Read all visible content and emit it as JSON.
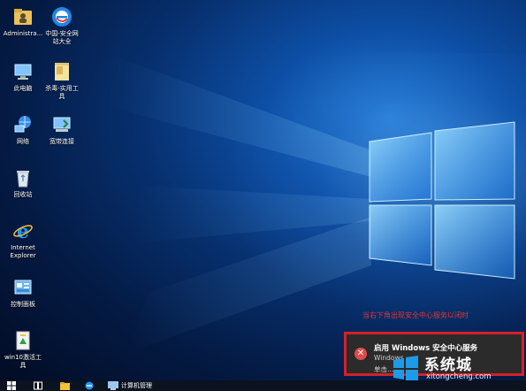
{
  "desktop": {
    "icons": [
      {
        "label": "Administra...",
        "icon": "user-folder-icon"
      },
      {
        "label": "中国-安全网\n站大全",
        "icon": "browser-e-icon"
      },
      {
        "label": "此电脑",
        "icon": "computer-icon"
      },
      {
        "label": "杀毒-实用工\n具",
        "icon": "folder-icon"
      },
      {
        "label": "网络",
        "icon": "network-icon"
      },
      {
        "label": "宽带连接",
        "icon": "broadband-icon"
      },
      {
        "label": "回收站",
        "icon": "recycle-bin-icon"
      },
      {
        "label": "Internet\nExplorer",
        "icon": "ie-icon"
      },
      {
        "label": "控制面板",
        "icon": "control-panel-icon"
      },
      {
        "label": "win10激活工\n具",
        "icon": "activation-tool-icon"
      }
    ]
  },
  "annotation": {
    "text": "当右下角出现安全中心服务以闭时",
    "color": "#e8322f"
  },
  "notification": {
    "title": "启用 Windows 安全中心服务",
    "line2": "Windows ...",
    "line3": "单击...",
    "border_color": "#d5202a",
    "icon": "error-x-icon"
  },
  "watermark": {
    "brand": "系统城",
    "url": "xitongcheng.com"
  },
  "taskbar": {
    "items": [
      {
        "icon": "start-icon"
      },
      {
        "icon": "task-view-icon"
      },
      {
        "icon": "file-explorer-icon"
      },
      {
        "icon": "ie-icon"
      },
      {
        "icon": "computer-management-icon",
        "label": "计算机管理"
      }
    ]
  }
}
